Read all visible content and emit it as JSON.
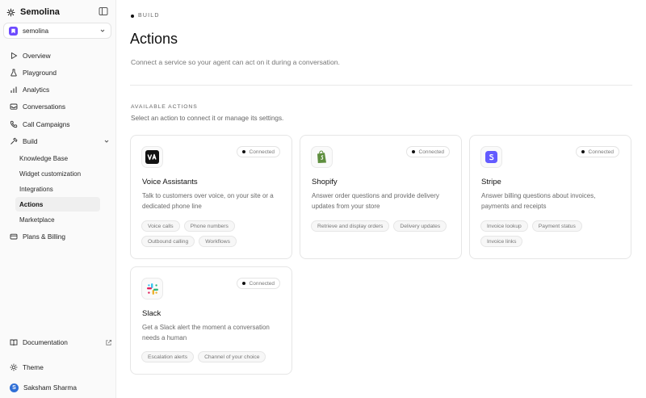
{
  "app": {
    "name": "Semolina"
  },
  "workspace": {
    "name": "semolina",
    "initial": "S"
  },
  "nav": {
    "overview": "Overview",
    "playground": "Playground",
    "analytics": "Analytics",
    "conversations": "Conversations",
    "call_campaigns": "Call Campaigns",
    "build": "Build",
    "build_children": [
      "Knowledge Base",
      "Widget customization",
      "Integrations",
      "Actions",
      "Marketplace"
    ],
    "plans_billing": "Plans & Billing",
    "documentation": "Documentation",
    "theme": "Theme"
  },
  "user": {
    "name": "Saksham Sharma",
    "initial": "S"
  },
  "page": {
    "eyebrow": "BUILD",
    "title": "Actions",
    "subtitle": "Connect a service so your agent can act on it during a conversation.",
    "section_label": "AVAILABLE ACTIONS",
    "section_desc": "Select an action to connect it or manage its settings."
  },
  "cards": [
    {
      "title": "Voice Assistants",
      "status": "Connected",
      "icon": "voice-assistants-logo",
      "desc": "Talk to customers over voice, on your site or a dedicated phone line",
      "tags": [
        "Voice calls",
        "Phone numbers",
        "Outbound calling",
        "Workflows"
      ]
    },
    {
      "title": "Shopify",
      "status": "Connected",
      "icon": "shopify-logo",
      "desc": "Answer order questions and provide delivery updates from your store",
      "tags": [
        "Retrieve and display orders",
        "Delivery updates"
      ]
    },
    {
      "title": "Stripe",
      "status": "Connected",
      "icon": "stripe-logo",
      "desc": "Answer billing questions about invoices, payments and receipts",
      "tags": [
        "Invoice lookup",
        "Payment status",
        "Invoice links"
      ]
    },
    {
      "title": "Slack",
      "status": "Connected",
      "icon": "slack-logo",
      "desc": "Get a Slack alert the moment a conversation needs a human",
      "tags": [
        "Escalation alerts",
        "Channel of your choice"
      ]
    }
  ],
  "colors": {
    "accent": "#6d4aff",
    "shopify": "#5e8e3e",
    "stripe": "#635bff"
  }
}
